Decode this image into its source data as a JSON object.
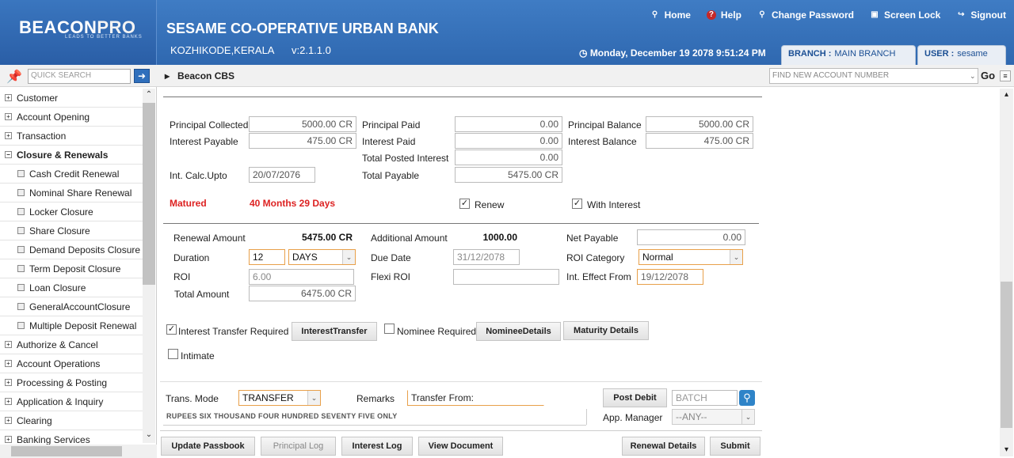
{
  "app": {
    "logo_text_1": "BEACON",
    "logo_text_2": "PRO",
    "logo_tagline": "LEADS TO BETTER BANKS",
    "bank_name": "SESAME CO-OPERATIVE URBAN BANK",
    "location": "KOZHIKODE,KERALA",
    "version": "v:2.1.1.0",
    "datetime": "Monday, December 19 2078 9:51:24 PM",
    "branch_label": "BRANCH :",
    "branch_value": "MAIN BRANCH",
    "user_label": "USER :",
    "user_value": "sesame"
  },
  "toplinks": [
    {
      "label": "Home",
      "icon": "search-icon"
    },
    {
      "label": "Help",
      "icon": "help-icon"
    },
    {
      "label": "Change Password",
      "icon": "key-icon"
    },
    {
      "label": "Screen Lock",
      "icon": "lock-icon"
    },
    {
      "label": "Signout",
      "icon": "signout-icon"
    }
  ],
  "toolbar": {
    "quick_search_placeholder": "QUICK SEARCH",
    "breadcrumb": "Beacon CBS",
    "new_account_placeholder": "FIND NEW ACCOUNT NUMBER",
    "go_label": "Go"
  },
  "sidebar": {
    "items": [
      {
        "label": "Customer"
      },
      {
        "label": "Account Opening"
      },
      {
        "label": "Transaction"
      },
      {
        "label": "Closure & Renewals"
      },
      {
        "label": "Cash Credit Renewal"
      },
      {
        "label": "Nominal Share Renewal"
      },
      {
        "label": "Locker Closure"
      },
      {
        "label": "Share Closure"
      },
      {
        "label": "Demand Deposits Closure"
      },
      {
        "label": "Term Deposit Closure"
      },
      {
        "label": "Loan Closure"
      },
      {
        "label": "GeneralAccountClosure"
      },
      {
        "label": "Multiple Deposit Renewal"
      },
      {
        "label": "Authorize & Cancel"
      },
      {
        "label": "Account Operations"
      },
      {
        "label": "Processing & Posting"
      },
      {
        "label": "Application & Inquiry"
      },
      {
        "label": "Clearing"
      },
      {
        "label": "Banking Services"
      }
    ]
  },
  "summary": {
    "principal_collected_label": "Principal Collected",
    "principal_collected": "5000.00 CR",
    "interest_payable_label": "Interest Payable",
    "interest_payable": "475.00 CR",
    "principal_paid_label": "Principal Paid",
    "principal_paid": "0.00",
    "interest_paid_label": "Interest Paid",
    "interest_paid": "0.00",
    "total_posted_interest_label": "Total Posted Interest",
    "total_posted_interest": "0.00",
    "total_payable_label": "Total Payable",
    "total_payable": "5475.00 CR",
    "principal_balance_label": "Principal Balance",
    "principal_balance": "5000.00 CR",
    "interest_balance_label": "Interest Balance",
    "interest_balance": "475.00 CR",
    "int_calc_upto_label": "Int. Calc.Upto",
    "int_calc_upto": "20/07/2076",
    "matured_label": "Matured",
    "matured_period": "40 Months 29 Days",
    "renew_label": "Renew",
    "renew_checked": "✓",
    "with_interest_label": "With Interest",
    "with_interest_checked": "✓"
  },
  "renewal": {
    "renewal_amount_label": "Renewal Amount",
    "renewal_amount": "5475.00 CR",
    "additional_amount_label": "Additional Amount",
    "additional_amount": "1000.00",
    "net_payable_label": "Net Payable",
    "net_payable": "0.00",
    "duration_label": "Duration",
    "duration_value": "12",
    "duration_unit": "DAYS",
    "due_date_label": "Due Date",
    "due_date": "31/12/2078",
    "roi_category_label": "ROI Category",
    "roi_category": "Normal",
    "roi_label": "ROI",
    "roi": "6.00",
    "flexi_roi_label": "Flexi ROI",
    "flexi_roi": "",
    "int_effect_from_label": "Int. Effect From",
    "int_effect_from": "19/12/2078",
    "total_amount_label": "Total Amount",
    "total_amount": "6475.00 CR"
  },
  "options": {
    "interest_transfer_label": "Interest Transfer Required",
    "interest_transfer_checked": "✓",
    "interest_transfer_button": "InterestTransfer",
    "nominee_label": "Nominee Required",
    "nominee_button": "NomineeDetails",
    "maturity_button": "Maturity Details",
    "intimate_label": "Intimate"
  },
  "transaction": {
    "trans_mode_label": "Trans. Mode",
    "trans_mode": "TRANSFER",
    "remarks_label": "Remarks",
    "remarks": "Transfer From:",
    "post_debit_button": "Post Debit",
    "batch_placeholder": "BATCH",
    "amount_words": "RUPEES SIX THOUSAND FOUR HUNDRED SEVENTY FIVE ONLY",
    "app_manager_label": "App. Manager",
    "app_manager": "--ANY--"
  },
  "footer_buttons": {
    "update_passbook": "Update Passbook",
    "principal_log": "Principal Log",
    "interest_log": "Interest Log",
    "view_document": "View Document",
    "renewal_details": "Renewal Details",
    "submit": "Submit"
  }
}
